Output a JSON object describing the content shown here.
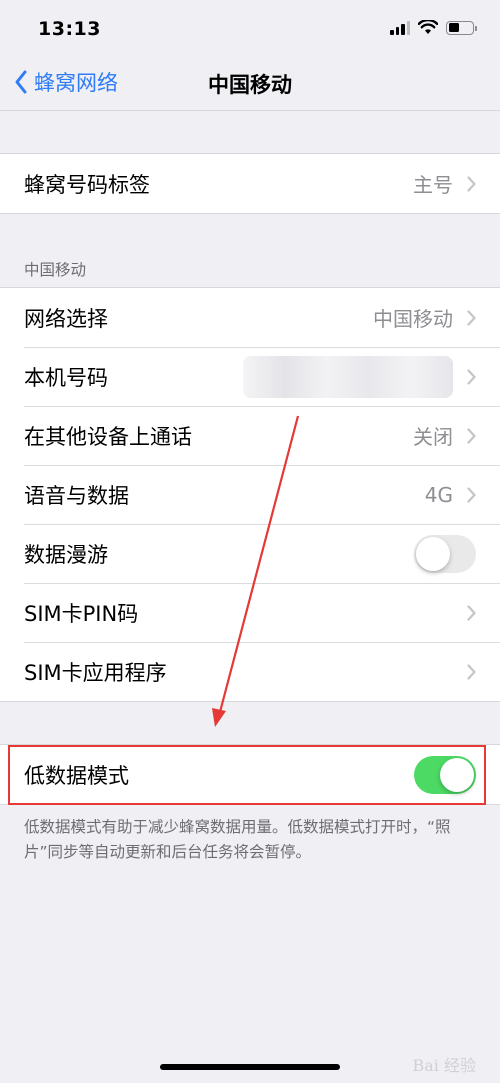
{
  "status_bar": {
    "time": "13:13"
  },
  "nav": {
    "back_label": "蜂窝网络",
    "title": "中国移动"
  },
  "group1": {
    "rows": [
      {
        "label": "蜂窝号码标签",
        "value": "主号"
      }
    ]
  },
  "section2": {
    "header": "中国移动",
    "rows": [
      {
        "label": "网络选择",
        "value": "中国移动"
      },
      {
        "label": "本机号码",
        "value": ""
      },
      {
        "label": "在其他设备上通话",
        "value": "关闭"
      },
      {
        "label": "语音与数据",
        "value": "4G"
      },
      {
        "label": "数据漫游",
        "toggle": "off"
      },
      {
        "label": "SIM卡PIN码",
        "value": ""
      },
      {
        "label": "SIM卡应用程序",
        "value": ""
      }
    ]
  },
  "group3": {
    "rows": [
      {
        "label": "低数据模式",
        "toggle": "on"
      }
    ],
    "footer": "低数据模式有助于减少蜂窝数据用量。低数据模式打开时，“照片”同步等自动更新和后台任务将会暂停。"
  },
  "watermark": "Bai 经验",
  "colors": {
    "accent": "#2f7cf6",
    "toggle_on": "#4cd964",
    "annotation": "#e53935"
  }
}
